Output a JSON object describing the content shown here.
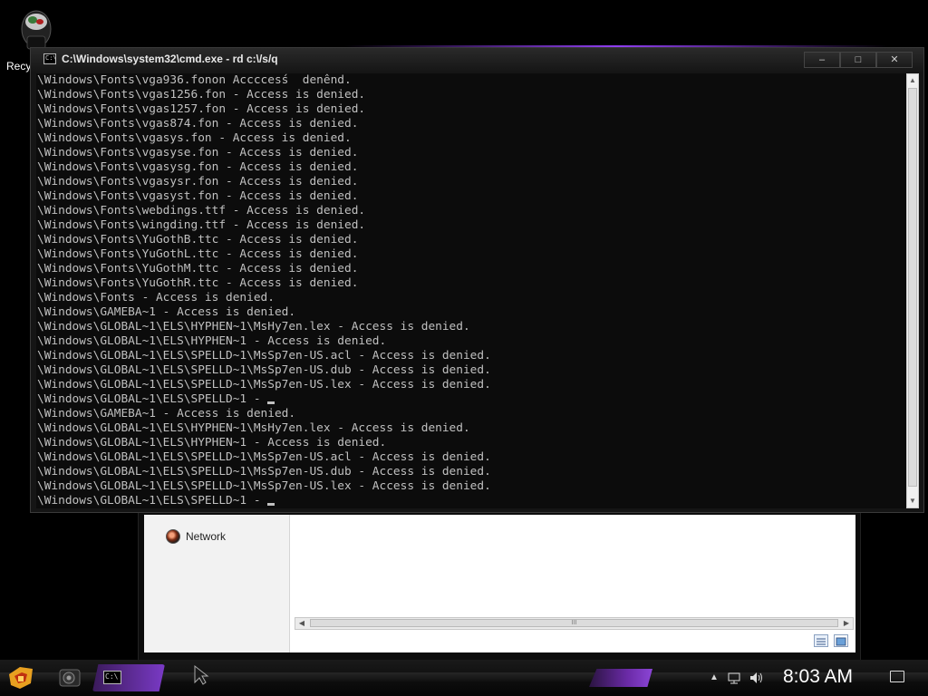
{
  "desktop": {
    "recycle_label": "Recy"
  },
  "explorer": {
    "nav_network": "Network",
    "scroll_grip": "III"
  },
  "cmd": {
    "title": "C:\\Windows\\system32\\cmd.exe - rd  c:\\/s/q",
    "minimize": "–",
    "maximize": "□",
    "close": "✕",
    "lines": [
      "\\Windows\\Fonts\\vga936.fonon Accccesś  denênd.",
      "\\Windows\\Fonts\\vgas1256.fon - Access is denied.",
      "\\Windows\\Fonts\\vgas1257.fon - Access is denied.",
      "\\Windows\\Fonts\\vgas874.fon - Access is denied.",
      "\\Windows\\Fonts\\vgasys.fon - Access is denied.",
      "\\Windows\\Fonts\\vgasyse.fon - Access is denied.",
      "\\Windows\\Fonts\\vgasysg.fon - Access is denied.",
      "\\Windows\\Fonts\\vgasysr.fon - Access is denied.",
      "\\Windows\\Fonts\\vgasyst.fon - Access is denied.",
      "\\Windows\\Fonts\\webdings.ttf - Access is denied.",
      "\\Windows\\Fonts\\wingding.ttf - Access is denied.",
      "\\Windows\\Fonts\\YuGothB.ttc - Access is denied.",
      "\\Windows\\Fonts\\YuGothL.ttc - Access is denied.",
      "\\Windows\\Fonts\\YuGothM.ttc - Access is denied.",
      "\\Windows\\Fonts\\YuGothR.ttc - Access is denied.",
      "\\Windows\\Fonts - Access is denied.",
      "\\Windows\\GAMEBA~1 - Access is denied.",
      "\\Windows\\GLOBAL~1\\ELS\\HYPHEN~1\\MsHy7en.lex - Access is denied.",
      "\\Windows\\GLOBAL~1\\ELS\\HYPHEN~1 - Access is denied.",
      "\\Windows\\GLOBAL~1\\ELS\\SPELLD~1\\MsSp7en-US.acl - Access is denied.",
      "\\Windows\\GLOBAL~1\\ELS\\SPELLD~1\\MsSp7en-US.dub - Access is denied.",
      "\\Windows\\GLOBAL~1\\ELS\\SPELLD~1\\MsSp7en-US.lex - Access is denied.",
      "\\Windows\\GLOBAL~1\\ELS\\SPELLD~1 - ",
      "\\Windows\\GAMEBA~1 - Access is denied.",
      "\\Windows\\GLOBAL~1\\ELS\\HYPHEN~1\\MsHy7en.lex - Access is denied.",
      "\\Windows\\GLOBAL~1\\ELS\\HYPHEN~1 - Access is denied.",
      "\\Windows\\GLOBAL~1\\ELS\\SPELLD~1\\MsSp7en-US.acl - Access is denied.",
      "\\Windows\\GLOBAL~1\\ELS\\SPELLD~1\\MsSp7en-US.dub - Access is denied.",
      "\\Windows\\GLOBAL~1\\ELS\\SPELLD~1\\MsSp7en-US.lex - Access is denied.",
      "\\Windows\\GLOBAL~1\\ELS\\SPELLD~1 - "
    ],
    "cursor_lines": [
      22,
      29
    ]
  },
  "taskbar": {
    "clock": "8:03 AM",
    "accent_color": "#8b45d6"
  }
}
